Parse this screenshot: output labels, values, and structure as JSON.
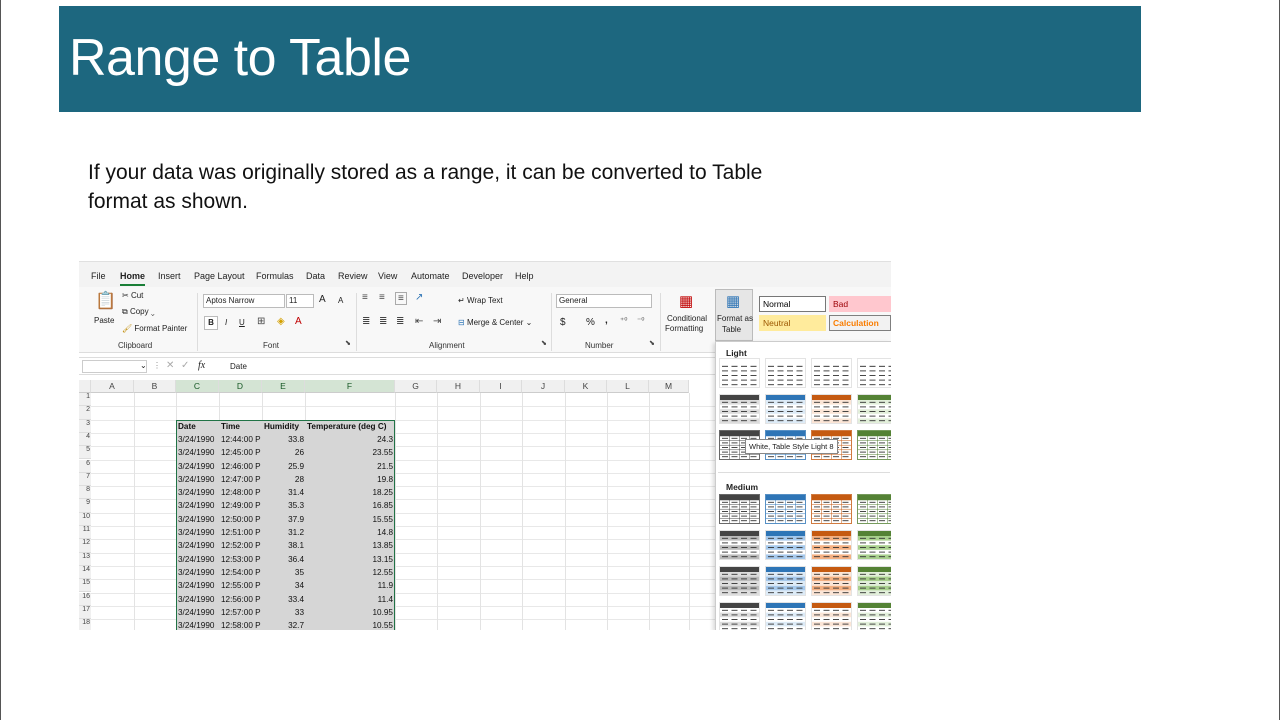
{
  "slide": {
    "title": "Range to Table",
    "description": "If your data was originally stored as a range, it can be converted to Table format as shown."
  },
  "excel": {
    "menu_tabs": [
      "File",
      "Home",
      "Insert",
      "Page Layout",
      "Formulas",
      "Data",
      "Review",
      "View",
      "Automate",
      "Developer",
      "Help"
    ],
    "clipboard": {
      "paste": "Paste",
      "cut": "Cut",
      "copy": "Copy",
      "format_painter": "Format Painter",
      "group": "Clipboard"
    },
    "font": {
      "name": "Aptos Narrow",
      "size": "11",
      "grow": "A",
      "shrink": "A",
      "bold": "B",
      "italic": "I",
      "underline": "U",
      "group": "Font"
    },
    "alignment": {
      "wrap": "Wrap Text",
      "merge": "Merge & Center",
      "group": "Alignment"
    },
    "number": {
      "format": "General",
      "currency": "$",
      "percent": "%",
      "comma": ",",
      "group": "Number"
    },
    "styles": {
      "conditional": "Conditional",
      "conditional2": "Formatting",
      "format_as": "Format as",
      "format_as2": "Table",
      "cells": [
        {
          "label": "Normal",
          "bg": "#ffffff",
          "fg": "#000000",
          "border": "#777777"
        },
        {
          "label": "Bad",
          "bg": "#ffc7ce",
          "fg": "#9c0006",
          "border": "#ffc7ce"
        },
        {
          "label": "Neutral",
          "bg": "#ffeb9c",
          "fg": "#9c5700",
          "border": "#ffeb9c"
        },
        {
          "label": "Calculation",
          "bg": "#f2f2f2",
          "fg": "#fa7d00",
          "border": "#7f7f7f"
        }
      ]
    },
    "formula_bar": {
      "fx": "fx",
      "value": "Date"
    },
    "columns": [
      "A",
      "B",
      "C",
      "D",
      "E",
      "F",
      "G",
      "H",
      "I",
      "J",
      "K",
      "L",
      "M"
    ],
    "rows": [
      "1",
      "2",
      "3",
      "4",
      "5",
      "6",
      "7",
      "8",
      "9",
      "10",
      "11",
      "12",
      "13",
      "14",
      "15",
      "16",
      "17",
      "18"
    ],
    "headers": [
      "Date",
      "Time",
      "Humidity",
      "Temperature (deg C)"
    ],
    "data": [
      [
        "3/24/1990",
        "12:44:00 P",
        "33.8",
        "24.3"
      ],
      [
        "3/24/1990",
        "12:45:00 P",
        "26",
        "23.55"
      ],
      [
        "3/24/1990",
        "12:46:00 P",
        "25.9",
        "21.5"
      ],
      [
        "3/24/1990",
        "12:47:00 P",
        "28",
        "19.8"
      ],
      [
        "3/24/1990",
        "12:48:00 P",
        "31.4",
        "18.25"
      ],
      [
        "3/24/1990",
        "12:49:00 P",
        "35.3",
        "16.85"
      ],
      [
        "3/24/1990",
        "12:50:00 P",
        "37.9",
        "15.55"
      ],
      [
        "3/24/1990",
        "12:51:00 P",
        "31.2",
        "14.8"
      ],
      [
        "3/24/1990",
        "12:52:00 P",
        "38.1",
        "13.85"
      ],
      [
        "3/24/1990",
        "12:53:00 P",
        "36.4",
        "13.15"
      ],
      [
        "3/24/1990",
        "12:54:00 P",
        "35",
        "12.55"
      ],
      [
        "3/24/1990",
        "12:55:00 P",
        "34",
        "11.9"
      ],
      [
        "3/24/1990",
        "12:56:00 P",
        "33.4",
        "11.4"
      ],
      [
        "3/24/1990",
        "12:57:00 P",
        "33",
        "10.95"
      ],
      [
        "3/24/1990",
        "12:58:00 P",
        "32.7",
        "10.55"
      ]
    ],
    "gallery": {
      "light_label": "Light",
      "medium_label": "Medium",
      "tooltip": "White, Table Style Light 8",
      "palette": [
        "#444444",
        "#2e75b6",
        "#c55a11",
        "#548235"
      ]
    }
  }
}
